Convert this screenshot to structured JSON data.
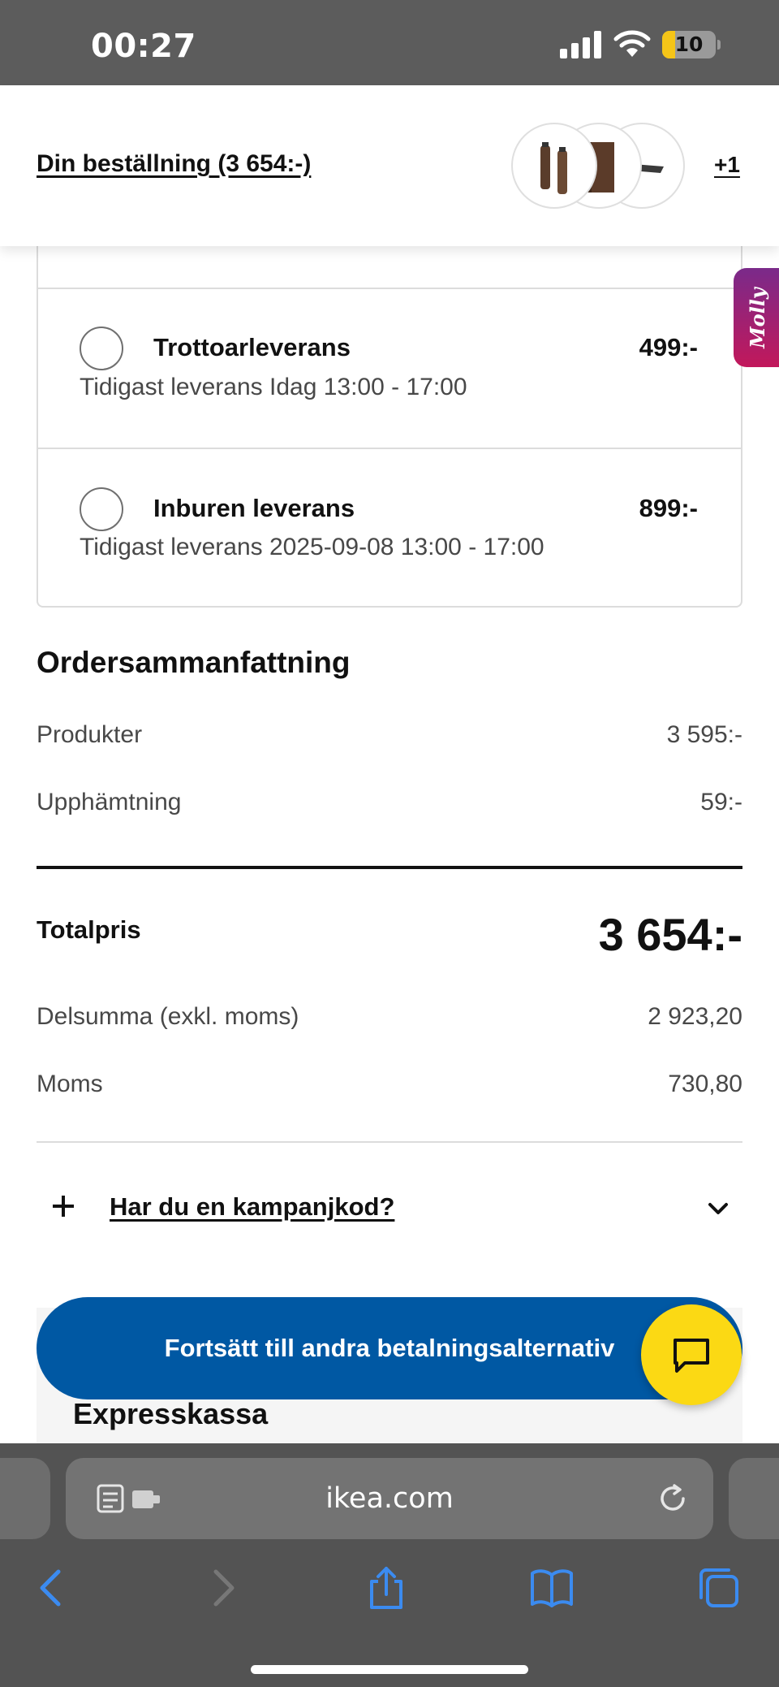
{
  "status_bar": {
    "time": "00:27",
    "battery_level": "10",
    "battery_fraction": 0.1
  },
  "order_header": {
    "title": "Din beställning (3 654:-)",
    "more_count": "+1"
  },
  "molly": {
    "label": "Molly"
  },
  "delivery_options": [
    {
      "title": "Trottoarleverans",
      "price": "499:-",
      "subtitle": "Tidigast leverans Idag 13:00 - 17:00",
      "selected": false
    },
    {
      "title": "Inburen leverans",
      "price": "899:-",
      "subtitle": "Tidigast leverans 2025-09-08 13:00 - 17:00",
      "selected": false
    }
  ],
  "summary": {
    "title": "Ordersammanfattning",
    "rows": [
      {
        "label": "Produkter",
        "value": "3 595:-"
      },
      {
        "label": "Upphämtning",
        "value": "59:-"
      }
    ],
    "total_label": "Totalpris",
    "total_value": "3 654:-",
    "tax_rows": [
      {
        "label": "Delsumma (exkl. moms)",
        "value": "2 923,20"
      },
      {
        "label": "Moms",
        "value": "730,80"
      }
    ]
  },
  "promo": {
    "label": "Har du en kampanjkod?"
  },
  "actions": {
    "continue_label": "Fortsätt till andra betalningsalternativ",
    "express_title": "Expresskassa"
  },
  "browser": {
    "url": "ikea.com"
  },
  "colors": {
    "ikea_blue": "#0058a3",
    "ikea_yellow": "#fbd914",
    "molly_gradient_start": "#7a2a8a",
    "molly_gradient_end": "#c2185b",
    "safari_blue": "#3b8bf0"
  },
  "icons": [
    "signal-icon",
    "wifi-icon",
    "battery-icon",
    "plus-icon",
    "chevron-down-icon",
    "chat-icon",
    "reader-icon",
    "reload-icon",
    "back-icon",
    "forward-icon",
    "share-icon",
    "bookmarks-icon",
    "tabs-icon"
  ]
}
